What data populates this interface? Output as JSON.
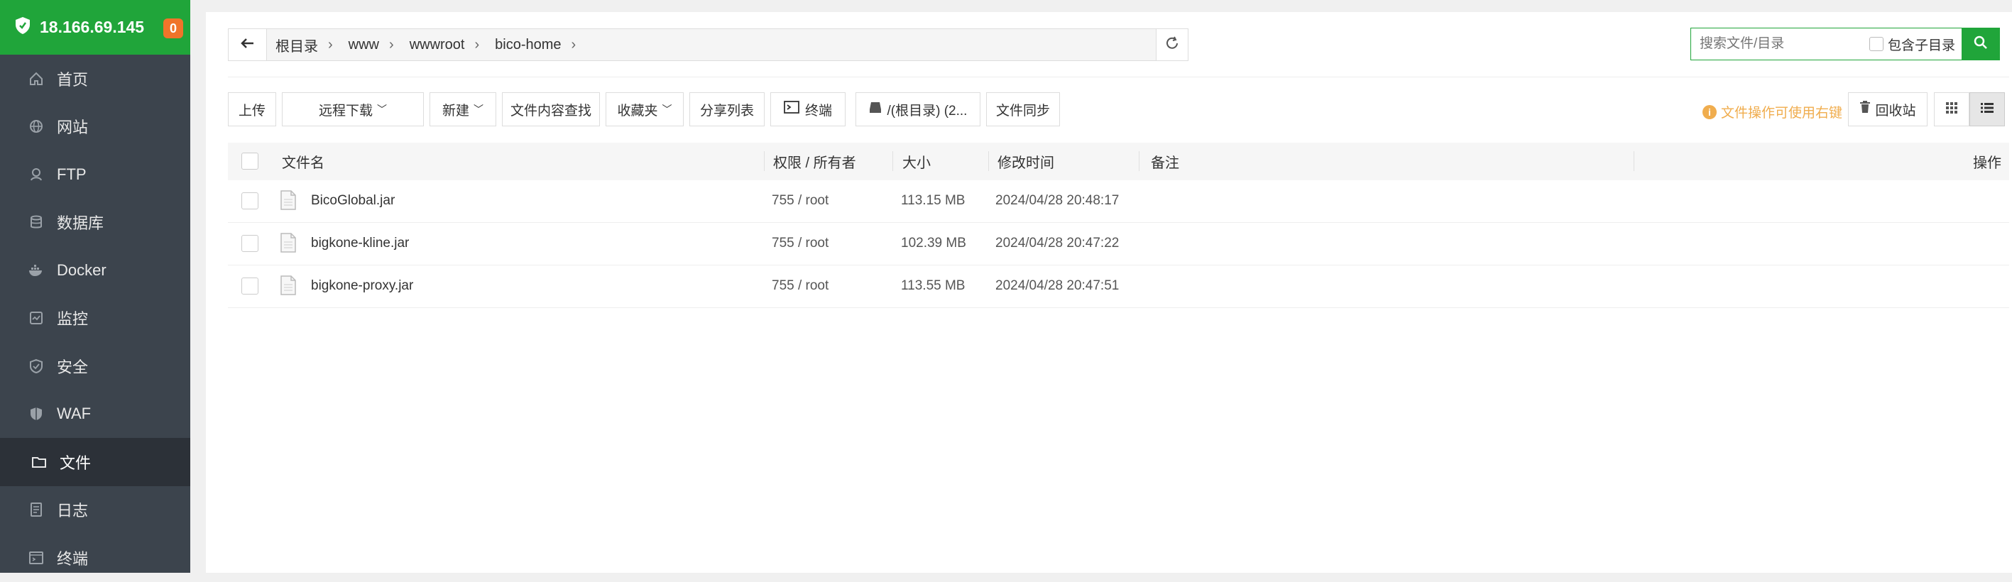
{
  "sidebar": {
    "server_ip": "18.166.69.145",
    "badge_count": "0",
    "items": [
      {
        "label": "首页",
        "icon": "home-icon"
      },
      {
        "label": "网站",
        "icon": "globe-icon"
      },
      {
        "label": "FTP",
        "icon": "ftp-icon"
      },
      {
        "label": "数据库",
        "icon": "database-icon"
      },
      {
        "label": "Docker",
        "icon": "docker-icon"
      },
      {
        "label": "监控",
        "icon": "monitor-icon"
      },
      {
        "label": "安全",
        "icon": "shield-icon"
      },
      {
        "label": "WAF",
        "icon": "waf-shield-icon"
      },
      {
        "label": "文件",
        "icon": "folder-icon",
        "active": true
      },
      {
        "label": "日志",
        "icon": "log-icon"
      },
      {
        "label": "终端",
        "icon": "terminal-icon"
      }
    ]
  },
  "path": {
    "crumbs": [
      "根目录",
      "www",
      "wwwroot",
      "bico-home"
    ]
  },
  "search": {
    "placeholder": "搜索文件/目录",
    "include_subdir_label": "包含子目录"
  },
  "toolbar": {
    "upload": "上传",
    "remote_download": "远程下载",
    "new": "新建",
    "content_search": "文件内容查找",
    "favorites": "收藏夹",
    "share_list": "分享列表",
    "terminal": "终端",
    "disk": "/(根目录) (2...",
    "sync": "文件同步",
    "tip": "文件操作可使用右键",
    "recycle": "回收站"
  },
  "table": {
    "headers": {
      "name": "文件名",
      "perm": "权限 / 所有者",
      "size": "大小",
      "mtime": "修改时间",
      "note": "备注",
      "ops": "操作"
    },
    "rows": [
      {
        "name": "BicoGlobal.jar",
        "perm": "755 / root",
        "size": "113.15 MB",
        "mtime": "2024/04/28 20:48:17"
      },
      {
        "name": "bigkone-kline.jar",
        "perm": "755 / root",
        "size": "102.39 MB",
        "mtime": "2024/04/28 20:47:22"
      },
      {
        "name": "bigkone-proxy.jar",
        "perm": "755 / root",
        "size": "113.55 MB",
        "mtime": "2024/04/28 20:47:51"
      }
    ]
  },
  "colors": {
    "brand_green": "#20a53a",
    "sidebar_bg": "#3c444d",
    "badge_orange": "#f0742a",
    "tip_orange": "#f0ad4e"
  }
}
